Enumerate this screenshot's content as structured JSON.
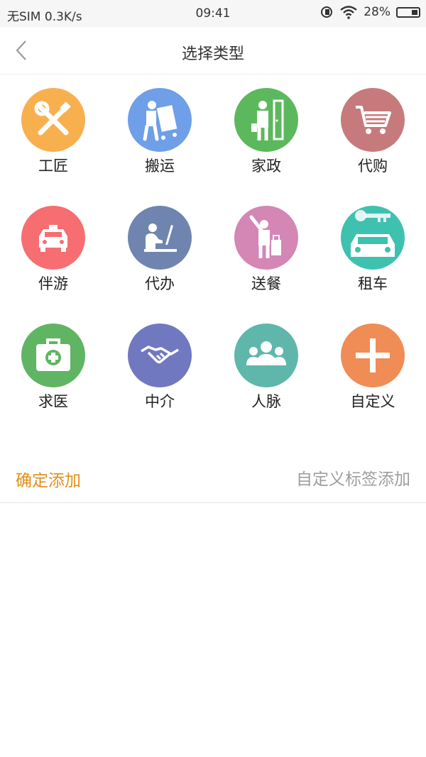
{
  "status_bar": {
    "carrier": "无SIM 0.3K/s",
    "time": "09:41",
    "battery": "28%"
  },
  "nav": {
    "title": "选择类型",
    "back_icon": "chevron-left-icon"
  },
  "categories": [
    {
      "label": "工匠",
      "icon": "tools-icon",
      "color": "#f8b04f"
    },
    {
      "label": "搬运",
      "icon": "mover-icon",
      "color": "#6e9fe8"
    },
    {
      "label": "家政",
      "icon": "housekeeping-icon",
      "color": "#5cb85c"
    },
    {
      "label": "代购",
      "icon": "shopping-cart-icon",
      "color": "#c77a7c"
    },
    {
      "label": "伴游",
      "icon": "taxi-icon",
      "color": "#f66e72"
    },
    {
      "label": "代办",
      "icon": "office-worker-icon",
      "color": "#6f85b0"
    },
    {
      "label": "送餐",
      "icon": "traveler-icon",
      "color": "#d486b5"
    },
    {
      "label": "租车",
      "icon": "car-key-icon",
      "color": "#3fc1b0"
    },
    {
      "label": "求医",
      "icon": "medical-kit-icon",
      "color": "#5fb563"
    },
    {
      "label": "中介",
      "icon": "handshake-icon",
      "color": "#7078c0"
    },
    {
      "label": "人脉",
      "icon": "people-icon",
      "color": "#5fb7ab"
    },
    {
      "label": "自定义",
      "icon": "plus-icon",
      "color": "#f08c55"
    }
  ],
  "actions": {
    "confirm_label": "确定添加",
    "custom_tag_label": "自定义标签添加",
    "confirm_color": "#e38d1a"
  }
}
